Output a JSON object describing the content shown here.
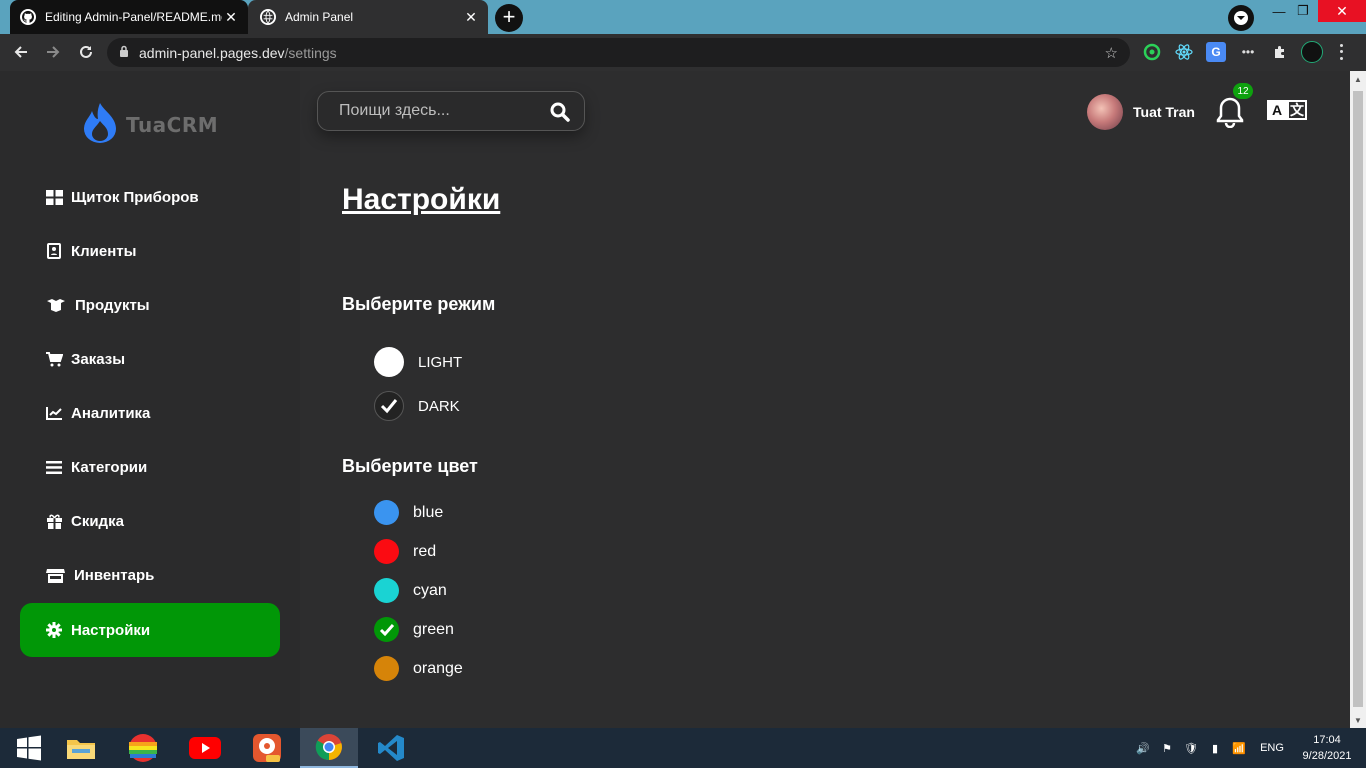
{
  "browser": {
    "tabs": [
      {
        "title": "Editing Admin-Panel/README.md",
        "favicon": "github-icon"
      },
      {
        "title": "Admin Panel",
        "favicon": "globe-icon"
      }
    ],
    "url_host": "admin-panel.pages.dev",
    "url_path": "/settings"
  },
  "app": {
    "logo_text": "TuaCRM",
    "search_placeholder": "Поищи здесь...",
    "user_name": "Tuat Tran",
    "notification_count": "12",
    "lang_a": "A",
    "lang_b": "文"
  },
  "sidebar": {
    "items": [
      {
        "label": "Щиток Приборов",
        "icon": "dashboard-icon"
      },
      {
        "label": "Клиенты",
        "icon": "contact-card-icon"
      },
      {
        "label": "Продукты",
        "icon": "boxes-icon"
      },
      {
        "label": "Заказы",
        "icon": "cart-icon"
      },
      {
        "label": "Аналитика",
        "icon": "chart-line-icon"
      },
      {
        "label": "Категории",
        "icon": "list-icon"
      },
      {
        "label": "Скидка",
        "icon": "gift-icon"
      },
      {
        "label": "Инвентарь",
        "icon": "store-icon"
      },
      {
        "label": "Настройки",
        "icon": "gear-icon",
        "active": true
      }
    ]
  },
  "settings": {
    "title": "Настройки",
    "mode_title": "Выберите режим",
    "modes": [
      {
        "label": "LIGHT",
        "selected": false
      },
      {
        "label": "DARK",
        "selected": true
      }
    ],
    "color_title": "Выберите цвет",
    "colors": [
      {
        "label": "blue",
        "hex": "#3a94f0",
        "selected": false
      },
      {
        "label": "red",
        "hex": "#fb0b12",
        "selected": false
      },
      {
        "label": "cyan",
        "hex": "#1ad3d3",
        "selected": false
      },
      {
        "label": "green",
        "hex": "#019707",
        "selected": true
      },
      {
        "label": "orange",
        "hex": "#d68409",
        "selected": false
      }
    ]
  },
  "taskbar": {
    "language": "ENG",
    "time": "17:04",
    "date": "9/28/2021"
  }
}
